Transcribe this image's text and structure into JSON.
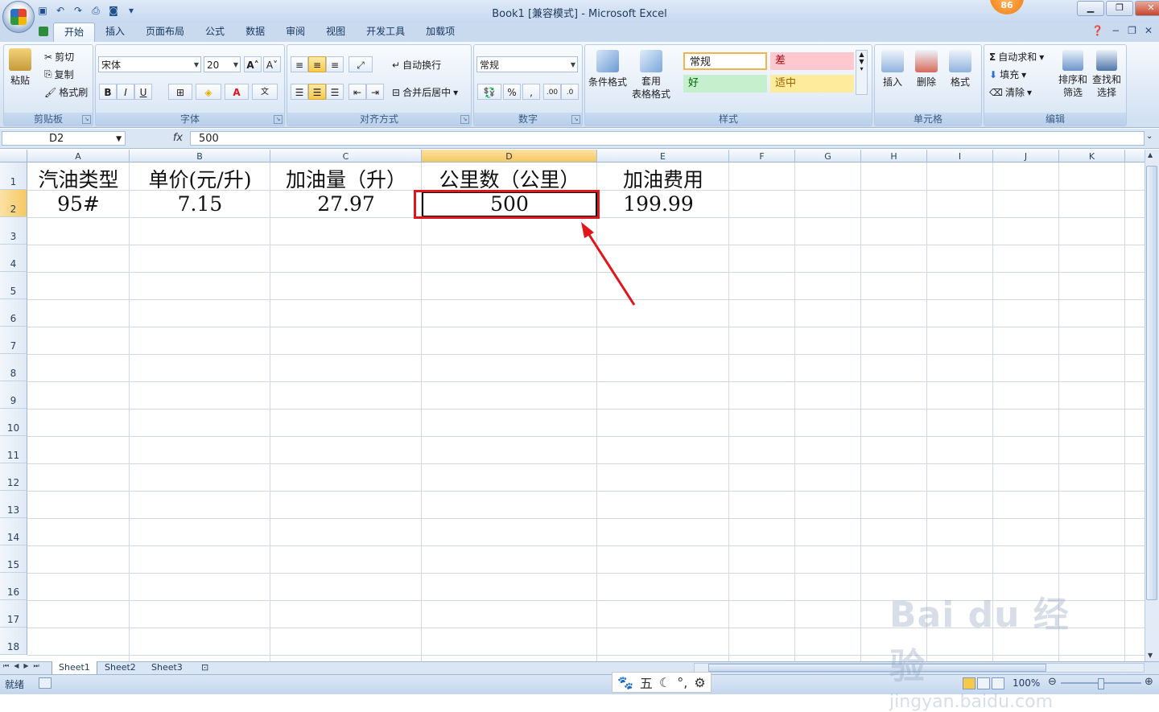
{
  "app": {
    "title": "Book1  [兼容模式] - Microsoft Excel",
    "notification_count": "86"
  },
  "ribbon": {
    "tabs": [
      "开始",
      "插入",
      "页面布局",
      "公式",
      "数据",
      "审阅",
      "视图",
      "开发工具",
      "加载项"
    ],
    "clipboard": {
      "label": "剪贴板",
      "paste": "粘贴",
      "cut": "剪切",
      "copy": "复制",
      "format_painter": "格式刷"
    },
    "font": {
      "label": "字体",
      "name": "宋体",
      "size": "20",
      "bold": "B",
      "italic": "I",
      "underline": "U"
    },
    "alignment": {
      "label": "对齐方式",
      "wrap": "自动换行",
      "merge": "合并后居中"
    },
    "number": {
      "label": "数字",
      "format": "常规",
      "percent": "%",
      "comma": ","
    },
    "styles": {
      "label": "样式",
      "conditional": "条件格式",
      "table_line1": "套用",
      "table_line2": "表格格式",
      "normal": "常规",
      "bad": "差",
      "good": "好",
      "neutral": "适中"
    },
    "cells": {
      "label": "单元格",
      "insert": "插入",
      "delete": "删除",
      "format": "格式"
    },
    "editing": {
      "label": "编辑",
      "autosum": "自动求和",
      "fill": "填充",
      "clear": "清除",
      "sort_line1": "排序和",
      "sort_line2": "筛选",
      "find_line1": "查找和",
      "find_line2": "选择"
    }
  },
  "formula_bar": {
    "name_box": "D2",
    "fx": "fx",
    "value": "500"
  },
  "columns": [
    "A",
    "B",
    "C",
    "D",
    "E",
    "F",
    "G",
    "H",
    "I",
    "J",
    "K"
  ],
  "rows": [
    "1",
    "2",
    "3",
    "4",
    "5",
    "6",
    "7",
    "8",
    "9",
    "10",
    "11",
    "12",
    "13",
    "14",
    "15",
    "16",
    "17",
    "18"
  ],
  "cells": {
    "A1": "汽油类型",
    "B1": "单价(元/升)",
    "C1": "加油量（升）",
    "D1": "公里数（公里）",
    "E1": "加油费用",
    "A2": "95#",
    "B2": "7.15",
    "C2": "27.97",
    "D2": "500",
    "E2": "199.99"
  },
  "sheets": [
    "Sheet1",
    "Sheet2",
    "Sheet3"
  ],
  "status": {
    "ready": "就绪",
    "zoom": "100%"
  },
  "ime": {
    "mode": "五"
  },
  "watermark": {
    "brand": "Bai du 经验",
    "url": "jingyan.baidu.com"
  },
  "colors": {
    "highlight": "#e4141b",
    "accent": "#f6c861"
  }
}
